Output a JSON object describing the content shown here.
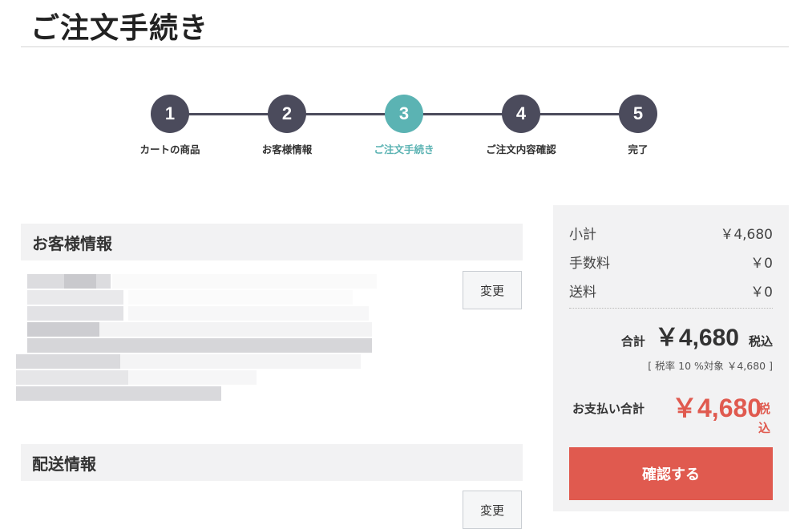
{
  "page": {
    "title": "ご注文手続き"
  },
  "steps": [
    {
      "number": "1",
      "label": "カートの商品"
    },
    {
      "number": "2",
      "label": "お客様情報"
    },
    {
      "number": "3",
      "label": "ご注文手続き"
    },
    {
      "number": "4",
      "label": "ご注文内容確認"
    },
    {
      "number": "5",
      "label": "完了"
    }
  ],
  "active_step": 3,
  "colors": {
    "primary": "#4b4b5c",
    "active": "#5bb3b3",
    "accent": "#e05a4f",
    "panel_bg": "#f2f2f3"
  },
  "customer": {
    "header": "お客様情報",
    "change_label": "変更"
  },
  "shipping": {
    "header": "配送情報",
    "change_label": "変更"
  },
  "summary": {
    "subtotal_label": "小計",
    "subtotal_value": "￥4,680",
    "fee_label": "手数料",
    "fee_value": "￥0",
    "shipping_label": "送料",
    "shipping_value": "￥0",
    "total_label": "合計",
    "total_value": "￥4,680",
    "total_tax": "税込",
    "tax_note": "[ 税率 10 %対象  ￥4,680 ]",
    "payment_label": "お支払い合計",
    "payment_value": "￥4,680",
    "payment_tax": "税込",
    "confirm_label": "確認する"
  }
}
